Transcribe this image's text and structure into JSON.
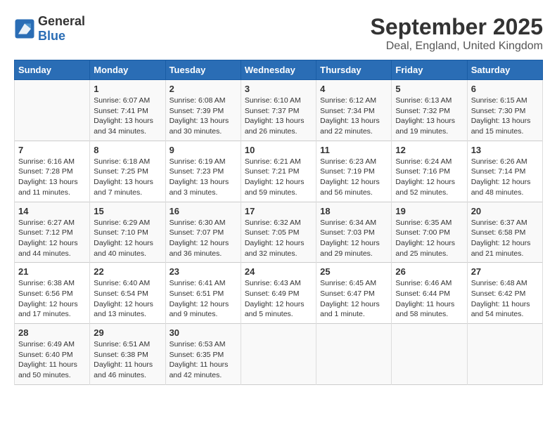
{
  "header": {
    "logo_general": "General",
    "logo_blue": "Blue",
    "title": "September 2025",
    "subtitle": "Deal, England, United Kingdom"
  },
  "columns": [
    "Sunday",
    "Monday",
    "Tuesday",
    "Wednesday",
    "Thursday",
    "Friday",
    "Saturday"
  ],
  "weeks": [
    [
      {
        "day": "",
        "info": ""
      },
      {
        "day": "1",
        "info": "Sunrise: 6:07 AM\nSunset: 7:41 PM\nDaylight: 13 hours\nand 34 minutes."
      },
      {
        "day": "2",
        "info": "Sunrise: 6:08 AM\nSunset: 7:39 PM\nDaylight: 13 hours\nand 30 minutes."
      },
      {
        "day": "3",
        "info": "Sunrise: 6:10 AM\nSunset: 7:37 PM\nDaylight: 13 hours\nand 26 minutes."
      },
      {
        "day": "4",
        "info": "Sunrise: 6:12 AM\nSunset: 7:34 PM\nDaylight: 13 hours\nand 22 minutes."
      },
      {
        "day": "5",
        "info": "Sunrise: 6:13 AM\nSunset: 7:32 PM\nDaylight: 13 hours\nand 19 minutes."
      },
      {
        "day": "6",
        "info": "Sunrise: 6:15 AM\nSunset: 7:30 PM\nDaylight: 13 hours\nand 15 minutes."
      }
    ],
    [
      {
        "day": "7",
        "info": "Sunrise: 6:16 AM\nSunset: 7:28 PM\nDaylight: 13 hours\nand 11 minutes."
      },
      {
        "day": "8",
        "info": "Sunrise: 6:18 AM\nSunset: 7:25 PM\nDaylight: 13 hours\nand 7 minutes."
      },
      {
        "day": "9",
        "info": "Sunrise: 6:19 AM\nSunset: 7:23 PM\nDaylight: 13 hours\nand 3 minutes."
      },
      {
        "day": "10",
        "info": "Sunrise: 6:21 AM\nSunset: 7:21 PM\nDaylight: 12 hours\nand 59 minutes."
      },
      {
        "day": "11",
        "info": "Sunrise: 6:23 AM\nSunset: 7:19 PM\nDaylight: 12 hours\nand 56 minutes."
      },
      {
        "day": "12",
        "info": "Sunrise: 6:24 AM\nSunset: 7:16 PM\nDaylight: 12 hours\nand 52 minutes."
      },
      {
        "day": "13",
        "info": "Sunrise: 6:26 AM\nSunset: 7:14 PM\nDaylight: 12 hours\nand 48 minutes."
      }
    ],
    [
      {
        "day": "14",
        "info": "Sunrise: 6:27 AM\nSunset: 7:12 PM\nDaylight: 12 hours\nand 44 minutes."
      },
      {
        "day": "15",
        "info": "Sunrise: 6:29 AM\nSunset: 7:10 PM\nDaylight: 12 hours\nand 40 minutes."
      },
      {
        "day": "16",
        "info": "Sunrise: 6:30 AM\nSunset: 7:07 PM\nDaylight: 12 hours\nand 36 minutes."
      },
      {
        "day": "17",
        "info": "Sunrise: 6:32 AM\nSunset: 7:05 PM\nDaylight: 12 hours\nand 32 minutes."
      },
      {
        "day": "18",
        "info": "Sunrise: 6:34 AM\nSunset: 7:03 PM\nDaylight: 12 hours\nand 29 minutes."
      },
      {
        "day": "19",
        "info": "Sunrise: 6:35 AM\nSunset: 7:00 PM\nDaylight: 12 hours\nand 25 minutes."
      },
      {
        "day": "20",
        "info": "Sunrise: 6:37 AM\nSunset: 6:58 PM\nDaylight: 12 hours\nand 21 minutes."
      }
    ],
    [
      {
        "day": "21",
        "info": "Sunrise: 6:38 AM\nSunset: 6:56 PM\nDaylight: 12 hours\nand 17 minutes."
      },
      {
        "day": "22",
        "info": "Sunrise: 6:40 AM\nSunset: 6:54 PM\nDaylight: 12 hours\nand 13 minutes."
      },
      {
        "day": "23",
        "info": "Sunrise: 6:41 AM\nSunset: 6:51 PM\nDaylight: 12 hours\nand 9 minutes."
      },
      {
        "day": "24",
        "info": "Sunrise: 6:43 AM\nSunset: 6:49 PM\nDaylight: 12 hours\nand 5 minutes."
      },
      {
        "day": "25",
        "info": "Sunrise: 6:45 AM\nSunset: 6:47 PM\nDaylight: 12 hours\nand 1 minute."
      },
      {
        "day": "26",
        "info": "Sunrise: 6:46 AM\nSunset: 6:44 PM\nDaylight: 11 hours\nand 58 minutes."
      },
      {
        "day": "27",
        "info": "Sunrise: 6:48 AM\nSunset: 6:42 PM\nDaylight: 11 hours\nand 54 minutes."
      }
    ],
    [
      {
        "day": "28",
        "info": "Sunrise: 6:49 AM\nSunset: 6:40 PM\nDaylight: 11 hours\nand 50 minutes."
      },
      {
        "day": "29",
        "info": "Sunrise: 6:51 AM\nSunset: 6:38 PM\nDaylight: 11 hours\nand 46 minutes."
      },
      {
        "day": "30",
        "info": "Sunrise: 6:53 AM\nSunset: 6:35 PM\nDaylight: 11 hours\nand 42 minutes."
      },
      {
        "day": "",
        "info": ""
      },
      {
        "day": "",
        "info": ""
      },
      {
        "day": "",
        "info": ""
      },
      {
        "day": "",
        "info": ""
      }
    ]
  ]
}
